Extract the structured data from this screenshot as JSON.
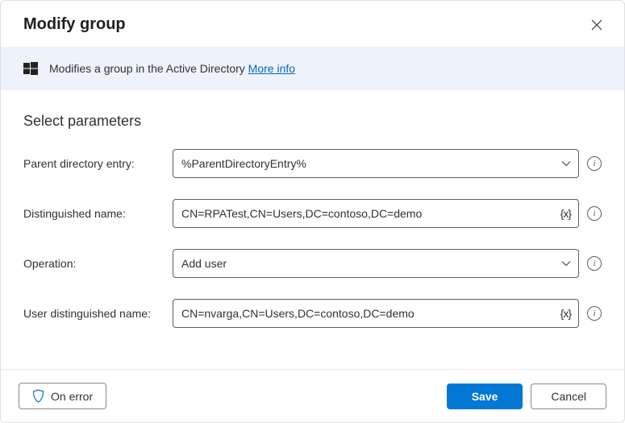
{
  "header": {
    "title": "Modify group"
  },
  "banner": {
    "text": "Modifies a group in the Active Directory ",
    "more_info": "More info"
  },
  "section": {
    "title": "Select parameters"
  },
  "form": {
    "parent_label": "Parent directory entry:",
    "parent_value": "%ParentDirectoryEntry%",
    "dn_label": "Distinguished name:",
    "dn_value": "CN=RPATest,CN=Users,DC=contoso,DC=demo",
    "operation_label": "Operation:",
    "operation_value": "Add user",
    "user_dn_label": "User distinguished name:",
    "user_dn_value": "CN=nvarga,CN=Users,DC=contoso,DC=demo",
    "var_token": "{x}"
  },
  "footer": {
    "on_error": "On error",
    "save": "Save",
    "cancel": "Cancel"
  }
}
